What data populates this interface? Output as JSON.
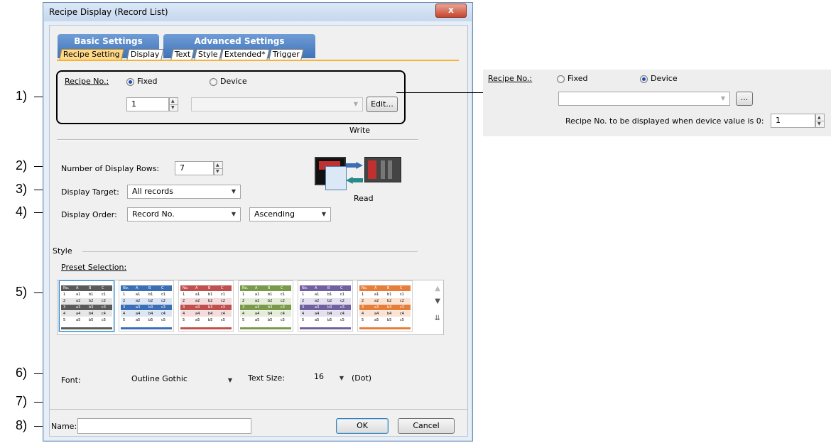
{
  "window": {
    "title": "Recipe Display (Record List)",
    "close_label": "x"
  },
  "callouts": [
    "1)",
    "2)",
    "3)",
    "4)",
    "5)",
    "6)",
    "7)",
    "8)"
  ],
  "tabs": {
    "basic": {
      "label": "Basic Settings",
      "subtabs": [
        "Recipe Setting",
        "Display"
      ]
    },
    "advanced": {
      "label": "Advanced Settings",
      "subtabs": [
        "Text",
        "Style",
        "Extended*",
        "Trigger"
      ]
    }
  },
  "recipe": {
    "label": "Recipe No.:",
    "fixed_label": "Fixed",
    "device_label": "Device",
    "selected": "Fixed",
    "value": "1",
    "device_value": "",
    "edit_button": "Edit..."
  },
  "display": {
    "rows_label": "Number of Display Rows:",
    "rows_value": "7",
    "target_label": "Display Target:",
    "target_value": "All records",
    "order_label": "Display Order:",
    "order_value": "Record No.",
    "order_direction": "Ascending"
  },
  "graphic": {
    "write_label": "Write",
    "read_label": "Read"
  },
  "style": {
    "section_label": "Style",
    "preset_label": "Preset Selection:",
    "preset_header": [
      "No.",
      "A",
      "B",
      "C"
    ],
    "preset_rows": [
      [
        "1",
        "a1",
        "b1",
        "c1"
      ],
      [
        "2",
        "a2",
        "b2",
        "c2"
      ],
      [
        "3",
        "a3",
        "b3",
        "c3"
      ],
      [
        "4",
        "a4",
        "b4",
        "c4"
      ],
      [
        "5",
        "a5",
        "b5",
        "c5"
      ]
    ],
    "preset_colors": [
      "#5a5a5a",
      "#3a6fb5",
      "#c0504d",
      "#7a9a4a",
      "#7060a0",
      "#e67e3a"
    ],
    "preset_light": [
      "#e6e6e6",
      "#dbe5f3",
      "#f3dcdb",
      "#e5ecd9",
      "#e4e0ef",
      "#fbe3d3"
    ]
  },
  "font": {
    "label": "Font:",
    "value": "Outline Gothic",
    "size_label": "Text Size:",
    "size_value": "16",
    "size_unit": "(Dot)"
  },
  "footer": {
    "name_label": "Name:",
    "name_value": "",
    "ok": "OK",
    "cancel": "Cancel"
  },
  "right_panel": {
    "label": "Recipe No.:",
    "fixed_label": "Fixed",
    "device_label": "Device",
    "selected": "Device",
    "device_value": "",
    "browse_button": "...",
    "zero_label": "Recipe No. to be displayed when device value is 0:",
    "zero_value": "1"
  }
}
